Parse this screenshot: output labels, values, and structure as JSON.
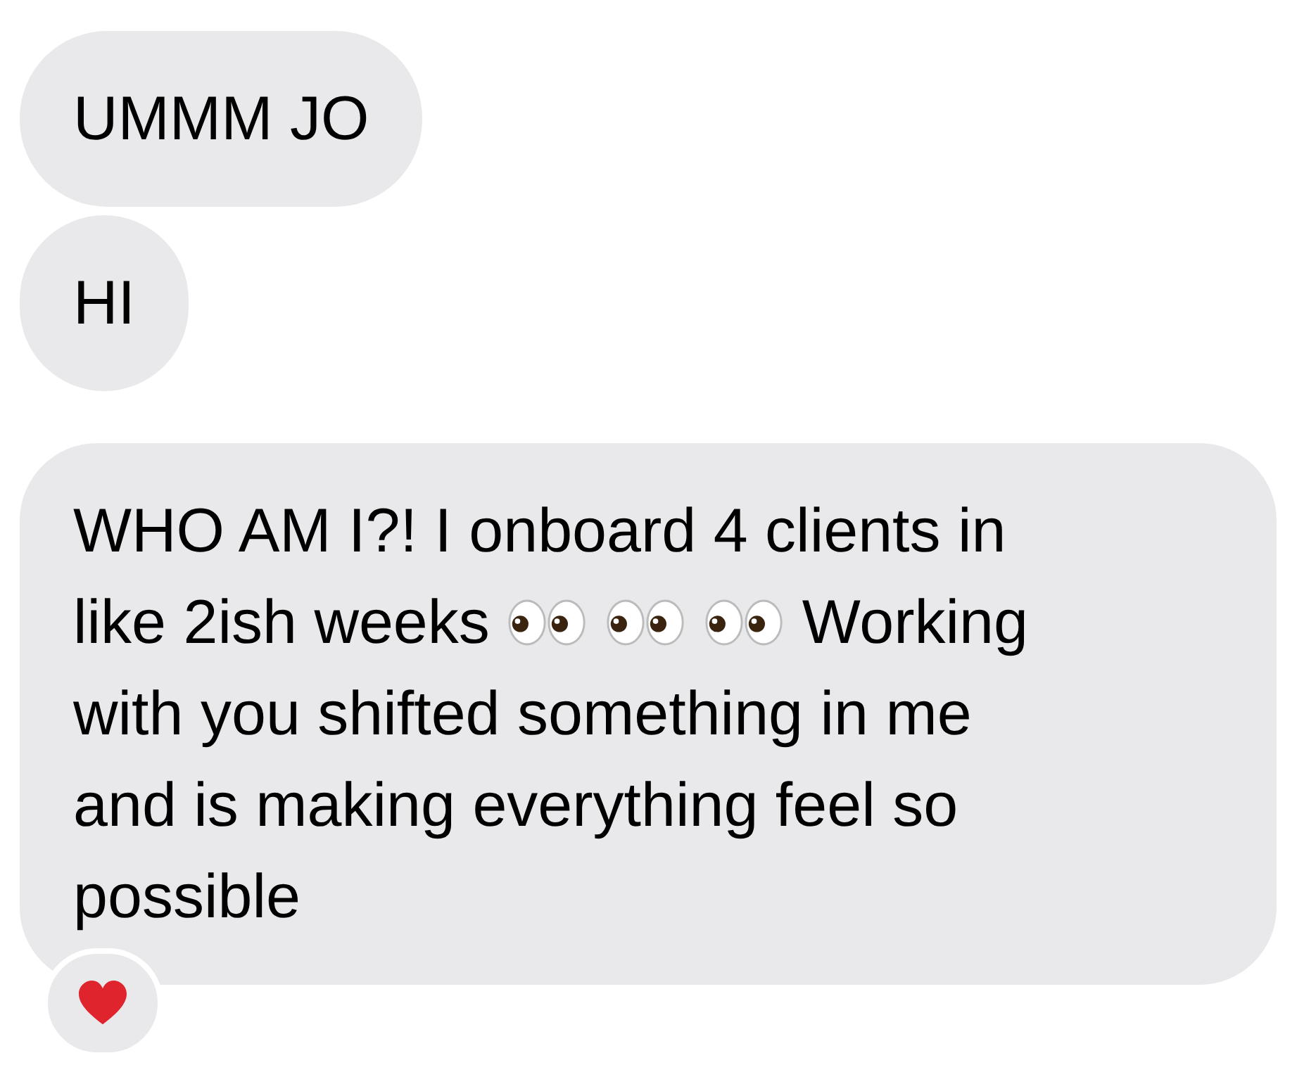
{
  "messages": [
    {
      "lines": [
        [
          {
            "kind": "text",
            "text": "UMMM JO"
          }
        ]
      ]
    },
    {
      "lines": [
        [
          {
            "kind": "text",
            "text": "HI"
          }
        ]
      ]
    },
    {
      "lines": [
        [
          {
            "kind": "text",
            "text": "WHO AM I?! I onboard 4 clients in"
          }
        ],
        [
          {
            "kind": "text",
            "text": "like 2ish weeks"
          },
          {
            "kind": "eyes"
          },
          {
            "kind": "eyes"
          },
          {
            "kind": "eyes"
          },
          {
            "kind": "text",
            "text": "Working"
          }
        ],
        [
          {
            "kind": "text",
            "text": "with you shifted something in me"
          }
        ],
        [
          {
            "kind": "text",
            "text": "and is making everything feel so"
          }
        ],
        [
          {
            "kind": "text",
            "text": "possible"
          }
        ]
      ],
      "reaction": {
        "kind": "heart"
      }
    }
  ]
}
